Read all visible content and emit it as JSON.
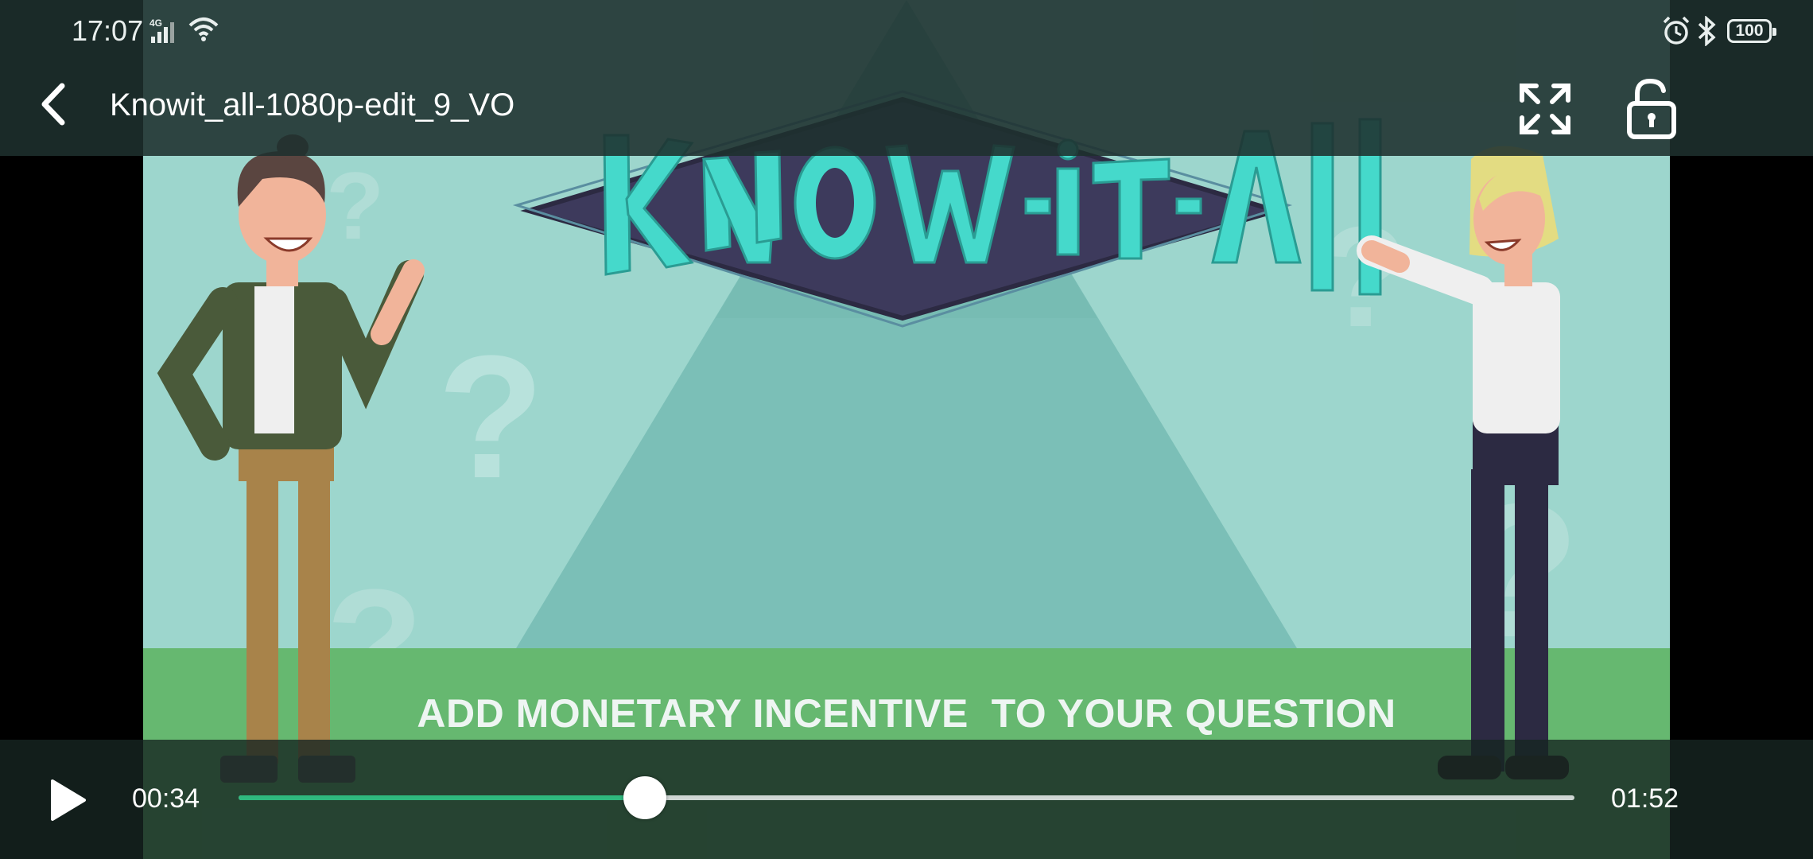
{
  "status_bar": {
    "time": "17:07",
    "network": "4G",
    "battery_level": "100",
    "icons": [
      "signal-icon",
      "wifi-icon",
      "alarm-icon",
      "bluetooth-icon",
      "battery-icon"
    ]
  },
  "header": {
    "title": "Knowit_all-1080p-edit_9_VO",
    "back_icon": "back-arrow-icon",
    "fullscreen_icon": "fullscreen-icon",
    "lock_icon": "unlock-icon"
  },
  "video": {
    "logo_text": "KNOW-iT-ALL",
    "caption": "ADD MONETARY INCENTIVE  TO YOUR QUESTION"
  },
  "controls": {
    "play_icon": "play-icon",
    "position": "00:34",
    "duration": "01:52",
    "progress_fraction": 0.304
  },
  "colors": {
    "accent": "#2fb97e",
    "video_bg": "#9dd6cd",
    "logo_teal": "#3fd6c9",
    "logo_diamond": "#3d3a5c"
  }
}
